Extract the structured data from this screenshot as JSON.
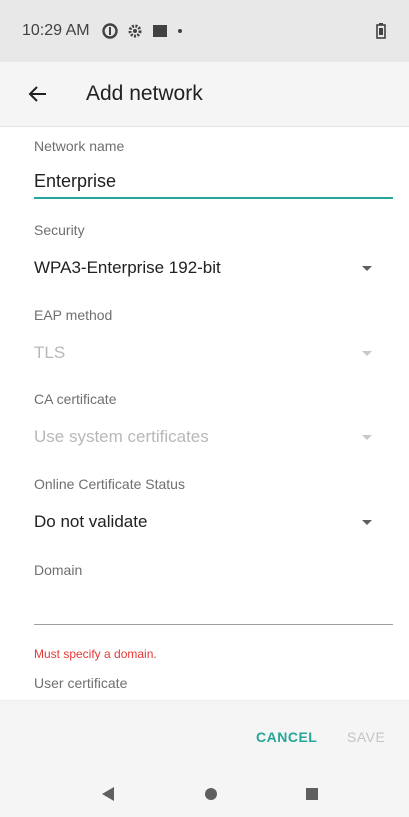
{
  "status_bar": {
    "time": "10:29 AM",
    "icons": [
      "data-saver-icon",
      "settings-gear-icon",
      "notification-square-icon",
      "dot-icon",
      "battery-icon"
    ]
  },
  "app_bar": {
    "title": "Add network",
    "back_icon": "arrow-back-icon"
  },
  "form": {
    "network_name": {
      "label": "Network name",
      "value": "Enterprise"
    },
    "security": {
      "label": "Security",
      "value": "WPA3-Enterprise 192-bit"
    },
    "eap_method": {
      "label": "EAP method",
      "value": "TLS"
    },
    "ca_certificate": {
      "label": "CA certificate",
      "value": "Use system certificates"
    },
    "ocsp": {
      "label": "Online Certificate Status",
      "value": "Do not validate"
    },
    "domain": {
      "label": "Domain",
      "value": "",
      "error": "Must specify a domain."
    },
    "user_certificate": {
      "label": "User certificate"
    }
  },
  "actions": {
    "cancel": "CANCEL",
    "save": "SAVE"
  },
  "navigation": {
    "icons": [
      "back-triangle-icon",
      "home-circle-icon",
      "recents-square-icon"
    ]
  },
  "colors": {
    "accent": "#26a69a",
    "error": "#e53935",
    "disabled": "#b8b8b8"
  }
}
